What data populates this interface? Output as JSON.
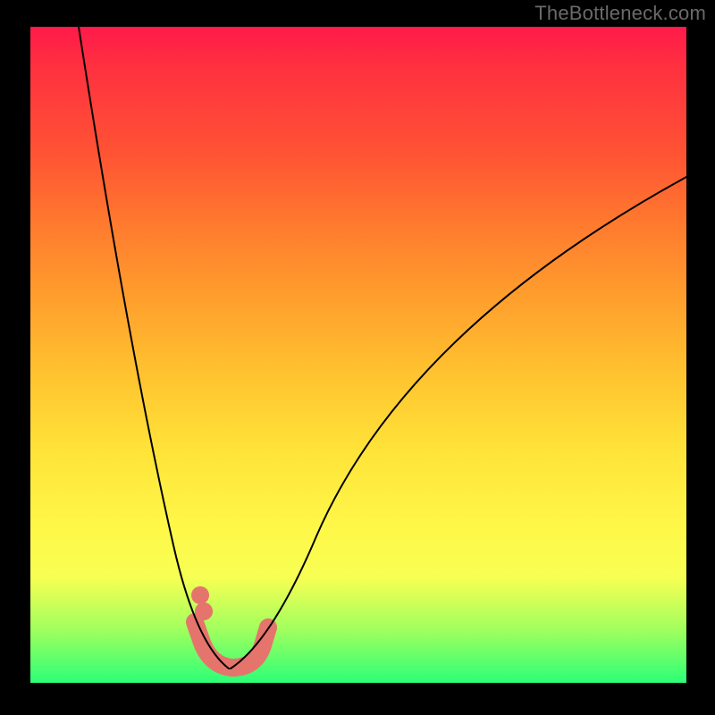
{
  "watermark": "TheBottleneck.com",
  "colors": {
    "gradient_top": "#ff1a4a",
    "gradient_mid": "#fff748",
    "gradient_bottom": "#2cff78",
    "curve": "#000000",
    "marker": "#e5746d",
    "frame": "#000000",
    "watermark_text": "#6a6a6a"
  },
  "chart_data": {
    "type": "line",
    "title": "",
    "xlabel": "",
    "ylabel": "",
    "xlim": [
      0,
      100
    ],
    "ylim": [
      0,
      100
    ],
    "grid": false,
    "legend": "none",
    "background": "vertical rainbow gradient (red top → green bottom)",
    "annotations": [
      {
        "text": "TheBottleneck.com",
        "position": "top-right",
        "role": "watermark"
      }
    ],
    "minimum": {
      "x": 30,
      "y": 2
    },
    "markers": [
      {
        "x": 25,
        "y": 9
      },
      {
        "x": 25.5,
        "y": 7
      },
      {
        "x": 26,
        "y": 13
      },
      {
        "x": 26.5,
        "y": 11
      },
      {
        "x": 36,
        "y": 8.5
      }
    ],
    "series": [
      {
        "name": "left-branch",
        "comment": "Steep descending arm; enters plot at top-left edge and falls to the trough.",
        "x_approx": [
          7,
          10,
          14,
          18,
          22,
          26,
          30
        ],
        "y_approx": [
          100,
          75,
          51,
          32,
          16,
          6,
          2
        ]
      },
      {
        "name": "right-branch",
        "comment": "Shallower ascending arm; rises from trough toward upper-right, exits right edge.",
        "x_approx": [
          30,
          36,
          44,
          57,
          75,
          100
        ],
        "y_approx": [
          2,
          10,
          22,
          40,
          60,
          77
        ]
      }
    ]
  }
}
